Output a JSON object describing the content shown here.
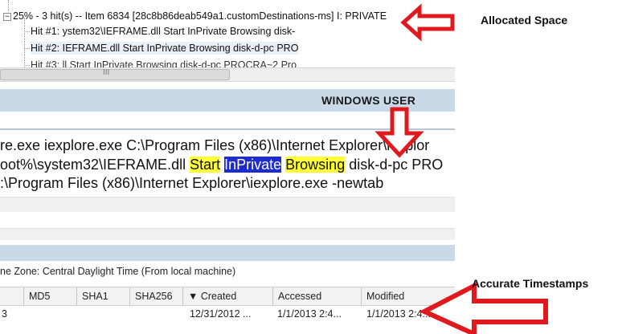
{
  "tree": {
    "node_expander": "−",
    "node_text": "25% - 3 hit(s) -- Item 6834 [28c8b86deab549a1.customDestinations-ms] I: PRIVATE",
    "hits": [
      "Hit #1: ystem32\\IEFRAME.dll Start InPrivate Browsing disk-",
      "Hit #2: IEFRAME.dll Start InPrivate Browsing disk-d-pc PRO",
      "Hit #3: ll Start InPrivate Browsing disk-d-pc PROCRA~2 Pro"
    ]
  },
  "scrollbar": {
    "grip": "III"
  },
  "header": {
    "title": "WINDOWS USER"
  },
  "detail": {
    "line1": "re.exe iexplore.exe C:\\Program Files (x86)\\Internet Explorer\\iexplor",
    "line2": {
      "prefix": "oot%\\system32\\IEFRAME.dll ",
      "w1": "Start",
      "w2": "InPrivate",
      "w3": "Browsing",
      "suffix": " disk-d-pc PRO"
    },
    "line3": ":\\Program Files (x86)\\Internet Explorer\\iexplore.exe -newtab"
  },
  "timezone": "ne Zone: Central Daylight Time  (From local machine)",
  "grid": {
    "columns": [
      "",
      "MD5",
      "SHA1",
      "SHA256",
      "▼  Created",
      "Accessed",
      "Modified"
    ],
    "row": [
      "3",
      "",
      "",
      "",
      "12/31/2012 ...",
      "1/1/2013 2:4...",
      "1/1/2013 2:4..."
    ]
  },
  "callouts": {
    "allocated": "Allocated Space",
    "timestamps": "Accurate Timestamps"
  },
  "colors": {
    "arrow": "#e0191f",
    "header_bar": "#c9d9e8",
    "highlight_yellow": "#ffff33",
    "highlight_blue": "#1d2bd0"
  }
}
